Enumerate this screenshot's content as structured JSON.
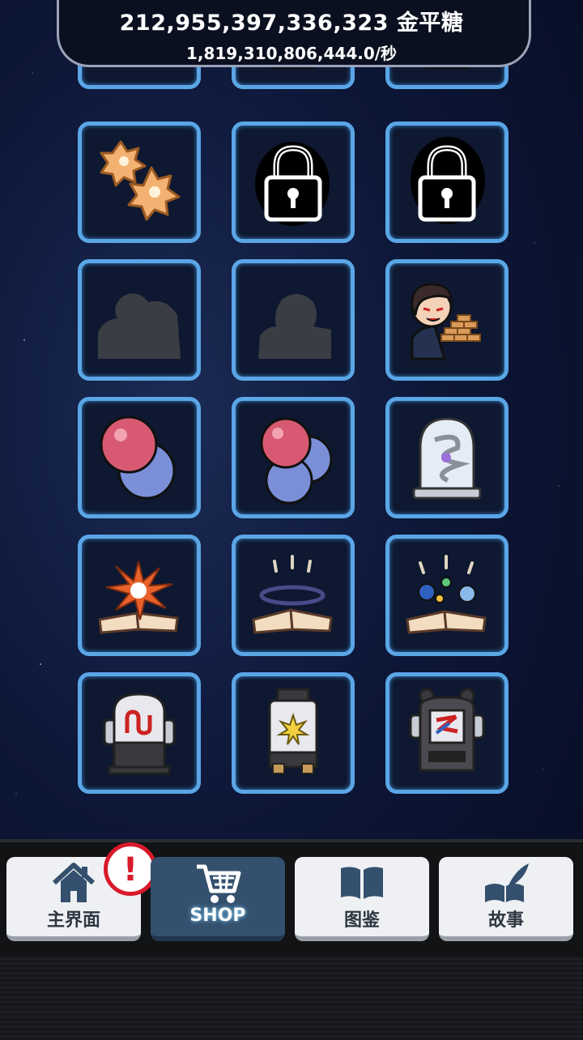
{
  "header": {
    "currency_amount": "212,955,397,336,323 金平糖",
    "currency_rate": "1,819,310,806,444.0/秒"
  },
  "shop_items": [
    {
      "icon": "locked-silhouette-icon",
      "state": "silhouette"
    },
    {
      "icon": "lock-icon",
      "state": "locked"
    },
    {
      "icon": "lock-icon",
      "state": "locked"
    },
    {
      "icon": "konpeito-candy-icon",
      "state": "owned"
    },
    {
      "icon": "lock-icon",
      "state": "locked"
    },
    {
      "icon": "lock-icon",
      "state": "locked"
    },
    {
      "icon": "silhouette-icon",
      "state": "silhouette"
    },
    {
      "icon": "silhouette-icon",
      "state": "silhouette"
    },
    {
      "icon": "character-with-candy-icon",
      "state": "owned"
    },
    {
      "icon": "two-spheres-icon",
      "state": "owned"
    },
    {
      "icon": "three-spheres-icon",
      "state": "owned"
    },
    {
      "icon": "glass-dome-spiral-icon",
      "state": "owned"
    },
    {
      "icon": "exploding-book-icon",
      "state": "owned"
    },
    {
      "icon": "book-ring-icon",
      "state": "owned"
    },
    {
      "icon": "book-planets-icon",
      "state": "owned"
    },
    {
      "icon": "machine-magnet-icon",
      "state": "owned"
    },
    {
      "icon": "machine-star-icon",
      "state": "owned"
    },
    {
      "icon": "machine-robot-icon",
      "state": "owned"
    }
  ],
  "nav": {
    "home": "主界面",
    "shop": "SHOP",
    "encyclopedia": "图鉴",
    "story": "故事",
    "alert_mark": "!"
  },
  "colors": {
    "cell_border": "#5aa6e6",
    "active_tab": "#34506e",
    "alert": "#d81a2a"
  }
}
